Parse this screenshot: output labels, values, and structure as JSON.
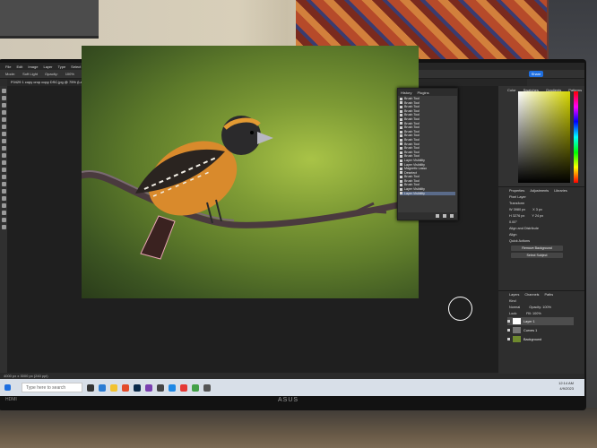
{
  "app": {
    "menu": [
      "File",
      "Edit",
      "Image",
      "Layer",
      "Type",
      "Select",
      "Filter",
      "3D",
      "View",
      "Plugins",
      "Window",
      "Help"
    ],
    "options": [
      "Mode:",
      "Soft Light",
      "Opacity:",
      "100%",
      "Smoothing:",
      "10%"
    ],
    "share_label": "Share",
    "doc_tab": "F0429 1 copy crop copy DSC.jpg @ 75% (Layer 1, RGB/8*)",
    "status": "4000 px x 3000 px (240 ppi)"
  },
  "history_panel": {
    "tabs": [
      "History",
      "Plugins"
    ],
    "items": [
      "Brush Tool",
      "Brush Tool",
      "Brush Tool",
      "Brush Tool",
      "Brush Tool",
      "Brush Tool",
      "Brush Tool",
      "Brush Tool",
      "Brush Tool",
      "Brush Tool",
      "Brush Tool",
      "Brush Tool",
      "Brush Tool",
      "Brush Tool",
      "Brush Tool",
      "Layer Visibility",
      "Layer Visibility",
      "Magnetic Lasso",
      "Deselect",
      "Brush Tool",
      "Brush Tool",
      "Brush Tool",
      "Layer Visibility",
      "Layer Visibility"
    ]
  },
  "color_panel": {
    "tabs": [
      "Color",
      "Swatches",
      "Gradients",
      "Patterns"
    ]
  },
  "properties_panel": {
    "tabs": [
      "Properties",
      "Adjustments",
      "Libraries"
    ],
    "layer_type": "Pixel Layer",
    "sections": [
      "Transform",
      "Align and Distribute",
      "Quick Actions"
    ],
    "align_label": "Align",
    "fields": [
      "W 3980 px",
      "X 3 px",
      "H 3276 px",
      "Y 24 px",
      "0.00°"
    ],
    "buttons": [
      "Remove Background",
      "Select Subject"
    ]
  },
  "layers_panel": {
    "tabs": [
      "Layers",
      "Channels",
      "Paths"
    ],
    "filter": "Kind",
    "blend": "Normal",
    "opacity": "Opacity: 100%",
    "fill": "Fill: 100%",
    "lock": "Lock:",
    "layers": [
      "Layer 1",
      "Curves 1",
      "Background"
    ]
  },
  "taskbar": {
    "search_placeholder": "Type here to search",
    "time": "12:14 AM",
    "date": "4/9/2023"
  },
  "monitor_brand": "ASUS",
  "port_label": "HDMI"
}
